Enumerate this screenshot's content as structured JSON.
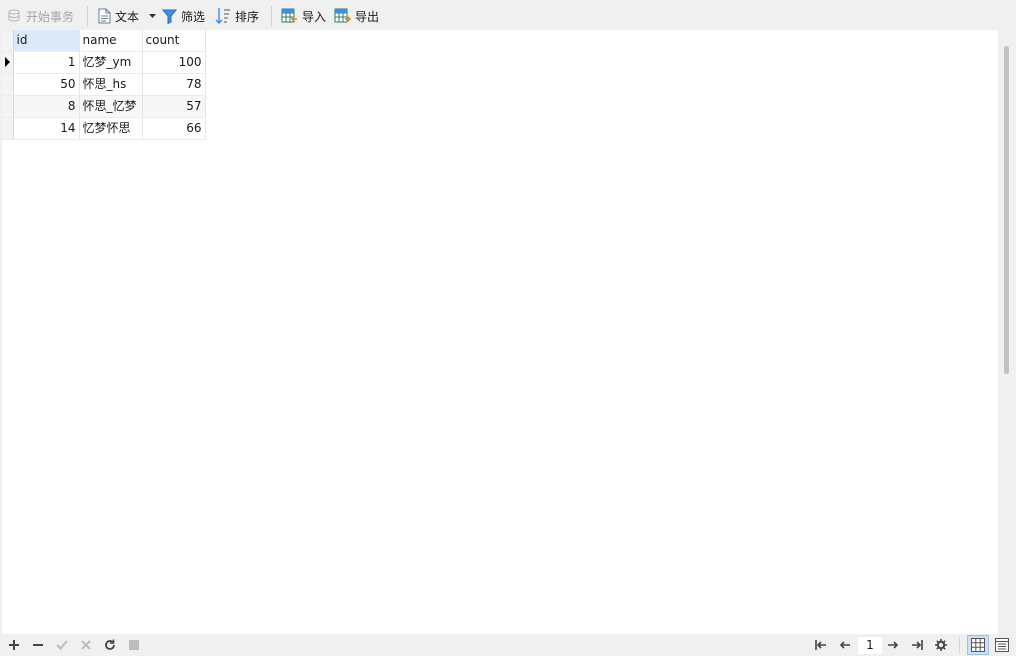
{
  "toolbar": {
    "begin_transaction": "开始事务",
    "text": "文本",
    "filter": "筛选",
    "sort": "排序",
    "import": "导入",
    "export": "导出"
  },
  "table": {
    "columns": [
      "id",
      "name",
      "count"
    ],
    "rows": [
      {
        "id": "1",
        "name": "忆梦_ym",
        "count": "100"
      },
      {
        "id": "50",
        "name": "怀思_hs",
        "count": "78"
      },
      {
        "id": "8",
        "name": "怀思_忆梦",
        "count": "57"
      },
      {
        "id": "14",
        "name": "忆梦怀思",
        "count": "66"
      }
    ]
  },
  "pagination": {
    "current_page": "1"
  },
  "icons": {
    "add": "plus-icon",
    "delete": "minus-icon",
    "apply": "check-icon",
    "discard": "x-icon",
    "refresh": "refresh-icon",
    "stop": "stop-icon",
    "first": "first-page-icon",
    "prev": "prev-page-icon",
    "next": "next-page-icon",
    "last": "last-page-icon",
    "settings": "gear-icon",
    "grid_view": "grid-view-icon",
    "form_view": "form-view-icon"
  },
  "colors": {
    "selected_header": "#dbe9f8",
    "accent": "#3a7bd5"
  }
}
